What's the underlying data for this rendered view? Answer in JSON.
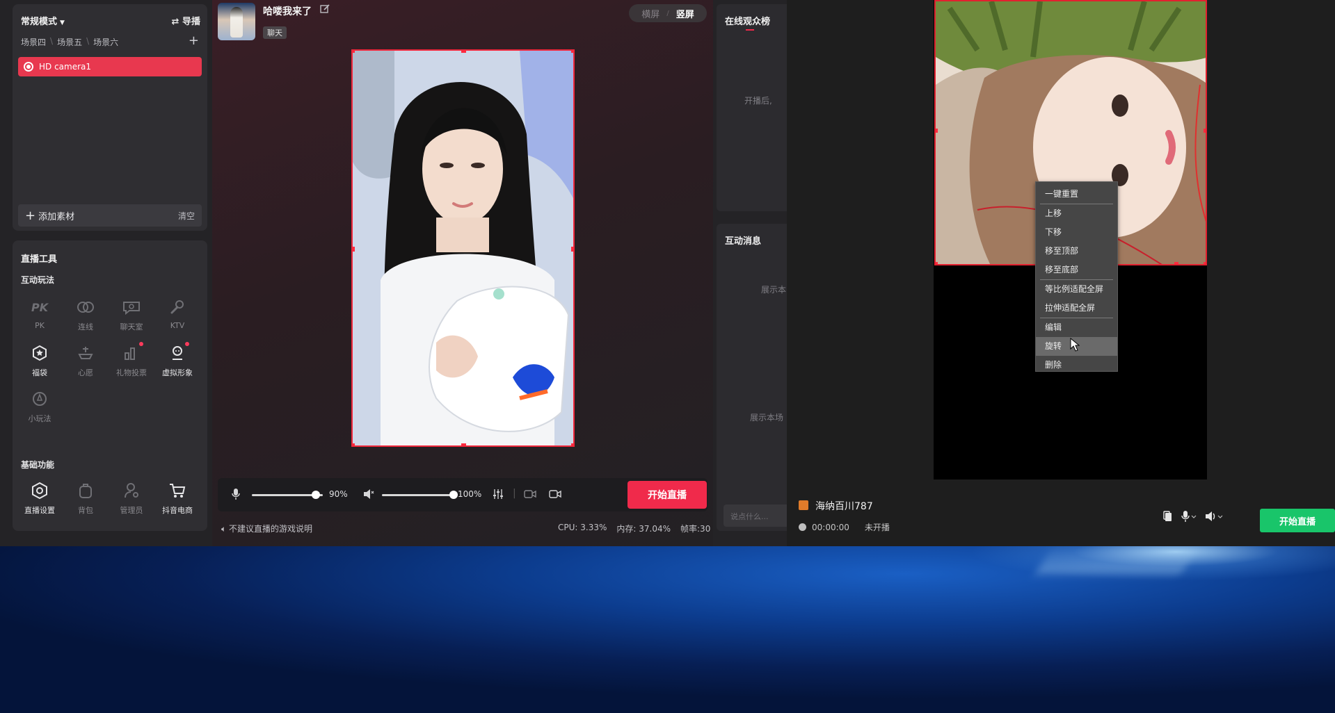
{
  "scene_panel": {
    "mode_label": "常规模式",
    "guide_label": "导播",
    "scene_tabs": [
      "场景四",
      "场景五",
      "场景六"
    ],
    "camera_source": "HD camera1",
    "add_material_label": "添加素材",
    "clear_label": "清空"
  },
  "tools_panel": {
    "title": "直播工具",
    "interactive_title": "互动玩法",
    "interactive_tools": [
      {
        "label": "PK",
        "icon": "pk-icon"
      },
      {
        "label": "连线",
        "icon": "link-icon"
      },
      {
        "label": "聊天室",
        "icon": "chat-room-icon"
      },
      {
        "label": "KTV",
        "icon": "microphone-icon"
      },
      {
        "label": "福袋",
        "icon": "lucky-bag-icon"
      },
      {
        "label": "心愿",
        "icon": "wish-icon"
      },
      {
        "label": "礼物投票",
        "icon": "gift-vote-icon"
      },
      {
        "label": "虚拟形象",
        "icon": "avatar-icon"
      },
      {
        "label": "小玩法",
        "icon": "mini-game-icon"
      }
    ],
    "basic_title": "基础功能",
    "basic_tools": [
      {
        "label": "直播设置",
        "icon": "settings-icon"
      },
      {
        "label": "背包",
        "icon": "backpack-icon"
      },
      {
        "label": "管理员",
        "icon": "admin-icon"
      },
      {
        "label": "抖音电商",
        "icon": "cart-icon"
      }
    ]
  },
  "header": {
    "room_title": "哈喽我来了",
    "room_tag": "聊天",
    "orientation_off": "横屏",
    "orientation_on": "竖屏"
  },
  "controls": {
    "mic_volume": "90%",
    "speaker_volume": "100%",
    "start_live_label": "开始直播",
    "mic_level": 0.9,
    "speaker_level": 1.0
  },
  "status": {
    "notice": "不建议直播的游戏说明",
    "cpu": "CPU: 3.33%",
    "memory": "内存: 37.04%",
    "fps": "帧率:30"
  },
  "side": {
    "audience_title": "在线观众榜",
    "audience_hint": "开播后,",
    "messages_title": "互动消息",
    "messages_hint1": "展示本",
    "messages_hint2": "展示本场",
    "input_placeholder": "说点什么..."
  },
  "context_menu": {
    "items": [
      "一键重置",
      "上移",
      "下移",
      "移至顶部",
      "移至底部",
      "等比例适配全屏",
      "拉伸适配全屏",
      "编辑",
      "旋转",
      "删除"
    ],
    "hovered": "旋转"
  },
  "app2": {
    "account_name": "海纳百川787",
    "timer": "00:00:00",
    "live_state": "未开播",
    "start_live_label": "开始直播"
  },
  "colors": {
    "accent_red": "#f02a4b",
    "accent_green": "#19c56a"
  }
}
